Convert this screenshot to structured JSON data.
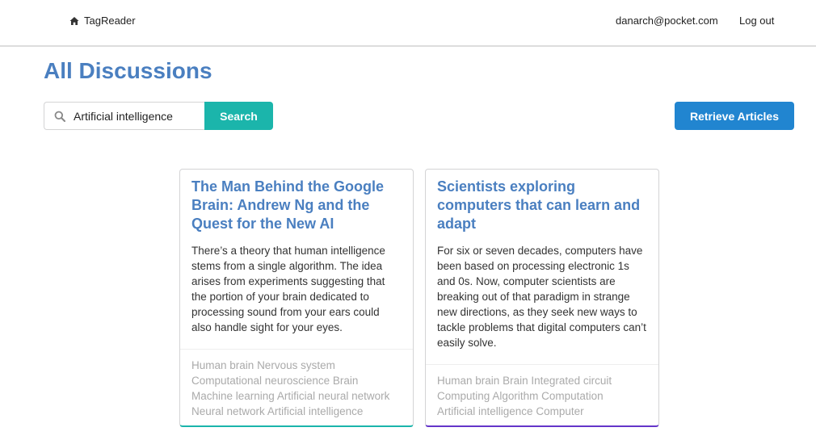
{
  "nav": {
    "brand_icon": "home-icon",
    "brand_label": "TagReader",
    "user_email": "danarch@pocket.com",
    "logout_label": "Log out"
  },
  "page": {
    "title": "All Discussions"
  },
  "search": {
    "icon": "search-icon",
    "value": "Artificial intelligence",
    "button_label": "Search",
    "button_color": "#1bb5ab"
  },
  "actions": {
    "retrieve_label": "Retrieve Articles",
    "retrieve_color": "#2185d0"
  },
  "articles": [
    {
      "title": "The Man Behind the Google Brain: Andrew Ng and the Quest for the New AI",
      "description": "There’s a theory that human intelligence stems from a single algorithm. The idea arises from experiments suggesting that the portion of your brain dedicated to processing sound from your ears could also handle sight for your eyes.",
      "tags": [
        "Human brain",
        "Nervous system",
        "Computational neuroscience",
        "Brain",
        "Machine learning",
        "Artificial neural network",
        "Neural network",
        "Artificial intelligence"
      ],
      "accent_color": "#1bb5ab"
    },
    {
      "title": "Scientists exploring computers that can learn and adapt",
      "description": "For six or seven decades, computers have been based on processing electronic 1s and 0s. Now, computer scientists are breaking out of that paradigm in strange new directions, as they seek new ways to tackle problems that digital computers can’t easily solve.",
      "tags": [
        "Human brain",
        "Brain",
        "Integrated circuit",
        "Computing",
        "Algorithm",
        "Computation",
        "Artificial intelligence",
        "Computer"
      ],
      "accent_color": "#6435c9"
    }
  ],
  "colors": {
    "title_blue": "#4a7fc0",
    "tag_gray": "#aaaaaa"
  }
}
